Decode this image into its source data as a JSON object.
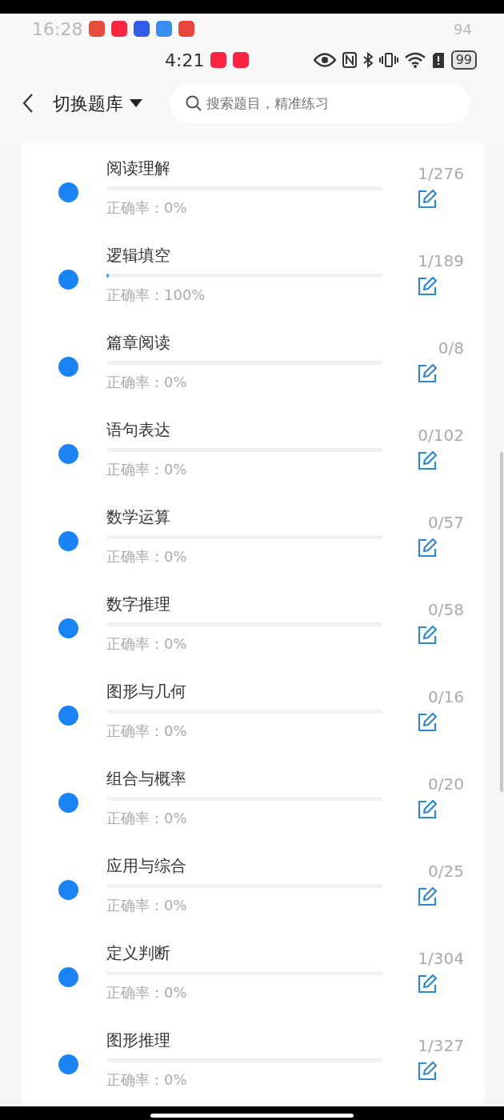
{
  "ghost_status": {
    "time": "16:28",
    "battery": "94"
  },
  "status_bar": {
    "time": "4:21",
    "battery": "99"
  },
  "header": {
    "title": "切换题库",
    "search": {
      "placeholder": "搜索题目，精准练习"
    }
  },
  "categories": [
    {
      "name": "阅读理解",
      "accuracy": "正确率：0%",
      "count": "1/276",
      "level": 0
    },
    {
      "name": "逻辑填空",
      "accuracy": "正确率：100%",
      "count": "1/189",
      "level": 0.01
    },
    {
      "name": "篇章阅读",
      "accuracy": "正确率：0%",
      "count": "0/8",
      "level": 0
    },
    {
      "name": "语句表达",
      "accuracy": "正确率：0%",
      "count": "0/102",
      "level": 0
    },
    {
      "name": "数学运算",
      "accuracy": "正确率：0%",
      "count": "0/57",
      "level": 0
    },
    {
      "name": "数字推理",
      "accuracy": "正确率：0%",
      "count": "0/58",
      "level": 0
    },
    {
      "name": "图形与几何",
      "accuracy": "正确率：0%",
      "count": "0/16",
      "level": 0
    },
    {
      "name": "组合与概率",
      "accuracy": "正确率：0%",
      "count": "0/20",
      "level": 0
    },
    {
      "name": "应用与综合",
      "accuracy": "正确率：0%",
      "count": "0/25",
      "level": 0
    },
    {
      "name": "定义判断",
      "accuracy": "正确率：0%",
      "count": "1/304",
      "level": 0
    },
    {
      "name": "图形推理",
      "accuracy": "正确率：0%",
      "count": "1/327",
      "level": 0
    }
  ]
}
